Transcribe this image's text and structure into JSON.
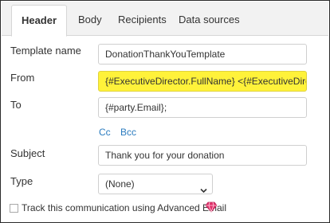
{
  "tabs": [
    {
      "label": "Header",
      "active": true
    },
    {
      "label": "Body",
      "active": false
    },
    {
      "label": "Recipients",
      "active": false
    },
    {
      "label": "Data sources",
      "active": false
    }
  ],
  "form": {
    "template_name": {
      "label": "Template name",
      "value": "DonationThankYouTemplate"
    },
    "from": {
      "label": "From",
      "value": "{#ExecutiveDirector.FullName} <{#ExecutiveDirector.E"
    },
    "to": {
      "label": "To",
      "value": "{#party.Email};"
    },
    "cc_label": "Cc",
    "bcc_label": "Bcc",
    "subject": {
      "label": "Subject",
      "value": "Thank you for your donation"
    },
    "type": {
      "label": "Type",
      "selected": "(None)"
    },
    "track_label": "Track this communication using Advanced Email",
    "track_checked": false
  },
  "icons": {
    "select_chevron": "chevron-down-icon",
    "premium": "gem-icon"
  },
  "colors": {
    "highlight": "#fff23a",
    "link": "#2a7bbf",
    "gem": "#e0306a"
  }
}
